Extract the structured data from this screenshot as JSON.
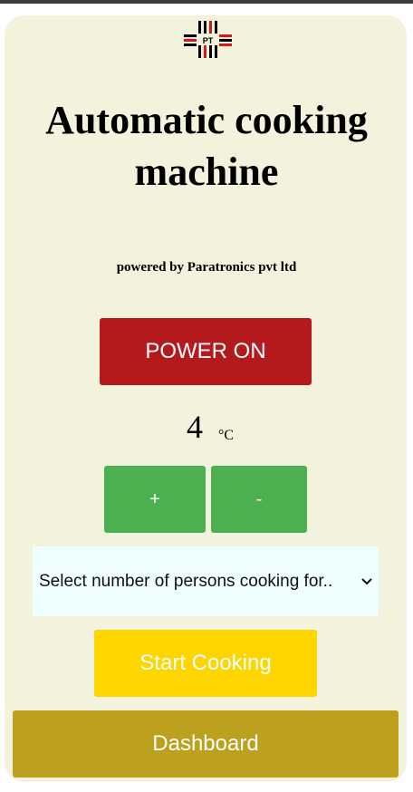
{
  "header": {
    "title": "Automatic cooking machine",
    "subtitle": "powered by Paratronics pvt ltd",
    "logo": {
      "text": "PT",
      "icon": "paratronics-logo-icon"
    }
  },
  "controls": {
    "power_label": "POWER ON",
    "temperature_value": "4",
    "temperature_unit": "°C",
    "increase_label": "+",
    "decrease_label": "-",
    "persons_select": {
      "selected": "Select number of persons cooking for..",
      "icon": "chevron-down-icon"
    },
    "start_label": "Start Cooking",
    "dashboard_label": "Dashboard"
  },
  "colors": {
    "page_bg": "#f3f3dd",
    "power": "#b4191c",
    "step_buttons": "#4caf50",
    "select_bg": "#effefe",
    "start": "#ffd500",
    "dashboard": "#bca01e"
  }
}
